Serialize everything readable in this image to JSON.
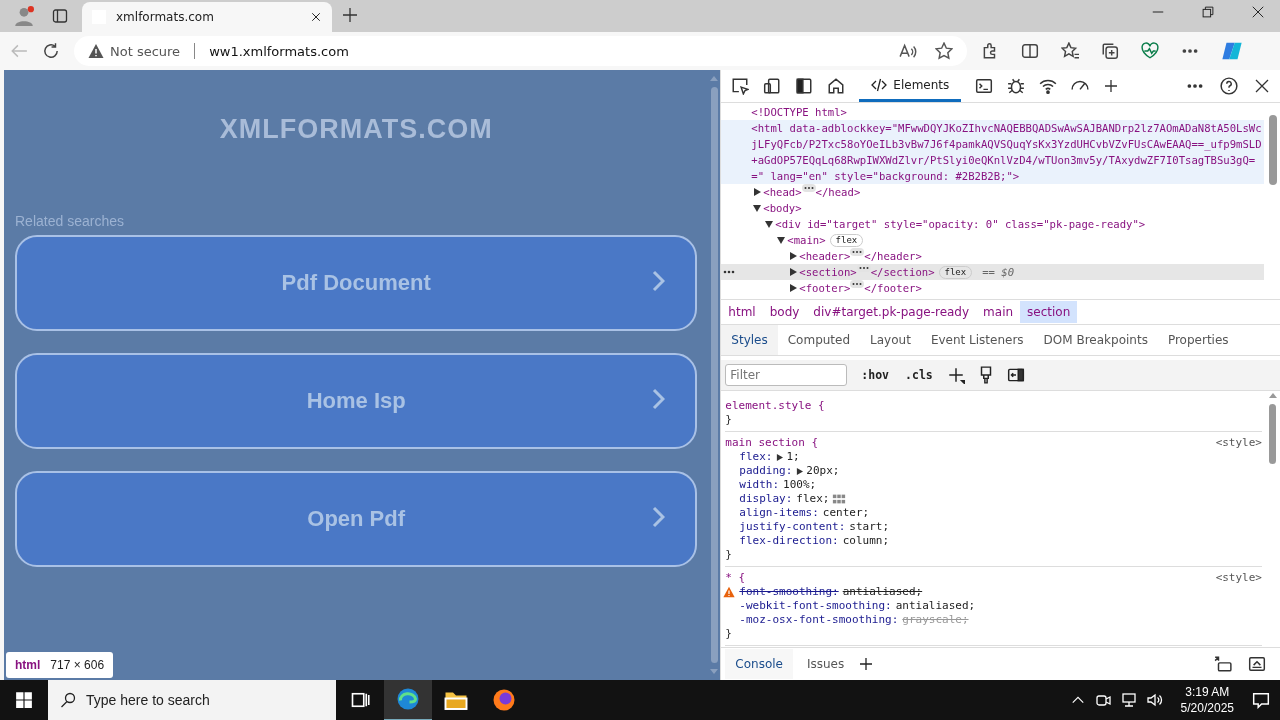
{
  "browser": {
    "tabs": [
      {
        "title": "xmlformats.com",
        "selected": true
      }
    ],
    "address": {
      "security": "Not secure",
      "url": "ww1.xmlformats.com"
    }
  },
  "page": {
    "title": "XMLFORMATS.COM",
    "related_label": "Related searches",
    "links": [
      {
        "label": "Pdf Document"
      },
      {
        "label": "Home Isp"
      },
      {
        "label": "Open Pdf"
      }
    ],
    "inspect_tooltip": {
      "tag": "html",
      "size": "717 × 606"
    }
  },
  "devtools": {
    "panel_tab": {
      "label": "Elements",
      "selected": true
    },
    "dom": [
      {
        "markup": "<!DOCTYPE html>"
      },
      {
        "markup": "<html data-adblockkey=\"MFwwDQYJKoZIhvcNAQEBBQADSwAwSAJBANDrp2lz7AOmADaN8tA50LsWcjLFyQFcb/P2Txc58oYOeILb3vBw7J6f4pamkAQVSQuqYsKx3YzdUHCvbVZvFUsCAwEAAQ==_ufp9mSLD+aGdOP57EQqLq68RwpIWXWdZlvr/PtSlyi0eQKnlVzD4/wTUon3mv5y/TAxydwZF7I0TsagTBSu3gQ==\" lang=\"en\" style=\"background: #2B2B2B;\">",
        "hovered": true,
        "children": [
          {
            "markup": "<head>",
            "expanded": false,
            "hidden_content": true,
            "close": "</head>"
          },
          {
            "markup": "<body>",
            "expanded": true,
            "children": [
              {
                "markup": "<div id=\"target\" style=\"opacity: 0\" class=\"pk-page-ready\">",
                "expanded": true,
                "children": [
                  {
                    "markup": "<main>",
                    "expanded": true,
                    "badge": "flex",
                    "children": [
                      {
                        "markup": "<header>",
                        "expanded": false,
                        "hidden_content": true,
                        "close": "</header>"
                      },
                      {
                        "markup": "<section>",
                        "expanded": false,
                        "hidden_content": true,
                        "close": "</section>",
                        "badge": "flex",
                        "suffix": "== $0",
                        "selected": true
                      },
                      {
                        "markup": "<footer>",
                        "expanded": false,
                        "hidden_content": true,
                        "close": "</footer>"
                      }
                    ]
                  }
                ]
              }
            ]
          }
        ]
      }
    ],
    "breadcrumbs": [
      {
        "label": "html",
        "selected": false
      },
      {
        "label": "body",
        "selected": false
      },
      {
        "label": "div#target.pk-page-ready",
        "selected": false
      },
      {
        "label": "main",
        "selected": false
      },
      {
        "label": "section",
        "selected": true
      }
    ],
    "subtabs": [
      {
        "label": "Styles",
        "selected": true
      },
      {
        "label": "Computed",
        "selected": false
      },
      {
        "label": "Layout",
        "selected": false
      },
      {
        "label": "Event Listeners",
        "selected": false
      },
      {
        "label": "DOM Breakpoints",
        "selected": false
      },
      {
        "label": "Properties",
        "selected": false
      }
    ],
    "filter": {
      "placeholder": "Filter"
    },
    "filter_buttons": [
      ":hov",
      ".cls"
    ],
    "rules": [
      {
        "open": "element.style {",
        "close": "}"
      },
      {
        "open": "main section {",
        "source": "<style>",
        "close": "}",
        "properties": [
          {
            "name": "flex:",
            "value": "1;",
            "expandable": true
          },
          {
            "name": "padding:",
            "value": "20px;",
            "expandable": true
          },
          {
            "name": "width:",
            "value": "100%;"
          },
          {
            "name": "display:",
            "value": "flex;",
            "flex_editor": true
          },
          {
            "name": "align-items:",
            "value": "center;"
          },
          {
            "name": "justify-content:",
            "value": "start;"
          },
          {
            "name": "flex-direction:",
            "value": "column;"
          }
        ]
      },
      {
        "open": "* {",
        "source": "<style>",
        "close": "}",
        "properties": [
          {
            "name": "font-smoothing:",
            "value": "antialiased;",
            "overridden": true,
            "warning": true
          },
          {
            "name": "-webkit-font-smoothing:",
            "value": "antialiased;"
          },
          {
            "name": "-moz-osx-font-smoothing:",
            "value": "grayscale;",
            "value_invalid": true
          }
        ]
      }
    ],
    "drawer_tabs": [
      {
        "label": "Console",
        "selected": true
      },
      {
        "label": "Issues",
        "selected": false
      }
    ]
  },
  "taskbar": {
    "search_placeholder": "Type here to search",
    "time": "3:19 AM",
    "date": "5/20/2025"
  }
}
